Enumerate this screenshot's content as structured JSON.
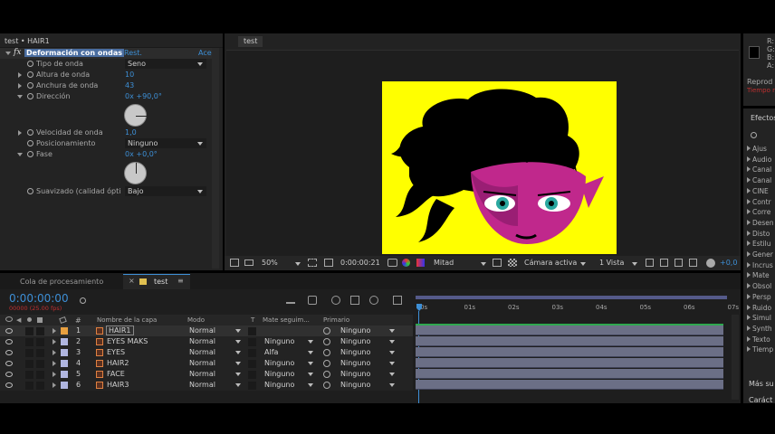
{
  "effect_controls": {
    "header": "test • HAIR1",
    "fx_label": "fx",
    "effect_name": "Deformación con ondas",
    "reset_label": "Rest.",
    "about_label": "Ace",
    "props": [
      {
        "name": "Tipo de onda",
        "value": "Seno"
      },
      {
        "name": "Altura de onda",
        "value": "10"
      },
      {
        "name": "Anchura de onda",
        "value": "43"
      },
      {
        "name": "Dirección",
        "value": "0x +90,0°"
      },
      {
        "name": "Velocidad de onda",
        "value": "1,0"
      },
      {
        "name": "Posicionamiento",
        "value": "Ninguno"
      },
      {
        "name": "Fase",
        "value": "0x +0,0°"
      },
      {
        "name": "Suavizado (calidad ópti",
        "value": "Bajo"
      }
    ]
  },
  "composition": {
    "tab": "test",
    "zoom": "50%",
    "timecode": "0:00:00:21",
    "resolution": "Mitad",
    "camera": "Cámara activa",
    "views": "1 Vista",
    "offset": "+0,0"
  },
  "info_panel": {
    "letters": [
      "R:",
      "G:",
      "B:",
      "A:"
    ],
    "reproduce": "Reprod",
    "reproduce_sub": "Tiempo real"
  },
  "effects_panel": {
    "title": "Efectos",
    "items": [
      "Ajus",
      "Audio",
      "Canal",
      "Canal",
      "CINE",
      "Contr",
      "Corre",
      "Desen",
      "Disto",
      "Estilu",
      "Gener",
      "Incrus",
      "Mate",
      "Obsol",
      "Persp",
      "Ruido",
      "Simul",
      "Synth",
      "Texto",
      "Tiemp"
    ],
    "more": "Más su",
    "bottom": "Caráct"
  },
  "timeline": {
    "tabs": [
      "Cola de procesamiento",
      "test"
    ],
    "timecode": "0:00:00:00",
    "fps": "00000 (25.00 fps)",
    "col_headers": {
      "num": "#",
      "name": "Nombre de la capa",
      "mode": "Modo",
      "t": "T",
      "matte": "Mate seguim...",
      "parent": "Primario"
    },
    "ruler": [
      "0s",
      "01s",
      "02s",
      "03s",
      "04s",
      "05s",
      "06s",
      "07s"
    ],
    "layers": [
      {
        "num": "1",
        "name": "HAIR1",
        "mode": "Normal",
        "matte": "",
        "parent": "Ninguno",
        "label_color": "#e8a040"
      },
      {
        "num": "2",
        "name": "EYES MAKS",
        "mode": "Normal",
        "matte": "Ninguno",
        "parent": "Ninguno",
        "label_color": "#b0b6e0"
      },
      {
        "num": "3",
        "name": "EYES",
        "mode": "Normal",
        "matte": "Alfa",
        "parent": "Ninguno",
        "label_color": "#b0b6e0"
      },
      {
        "num": "4",
        "name": "HAIR2",
        "mode": "Normal",
        "matte": "Ninguno",
        "parent": "Ninguno",
        "label_color": "#b0b6e0"
      },
      {
        "num": "5",
        "name": "FACE",
        "mode": "Normal",
        "matte": "Ninguno",
        "parent": "Ninguno",
        "label_color": "#b0b6e0"
      },
      {
        "num": "6",
        "name": "HAIR3",
        "mode": "Normal",
        "matte": "Ninguno",
        "parent": "Ninguno",
        "label_color": "#b0b6e0"
      }
    ]
  },
  "colors": {
    "accent": "#3d8fd6",
    "canvas_bg": "#ffff00",
    "face": "#c0288c",
    "hair": "#000000"
  }
}
